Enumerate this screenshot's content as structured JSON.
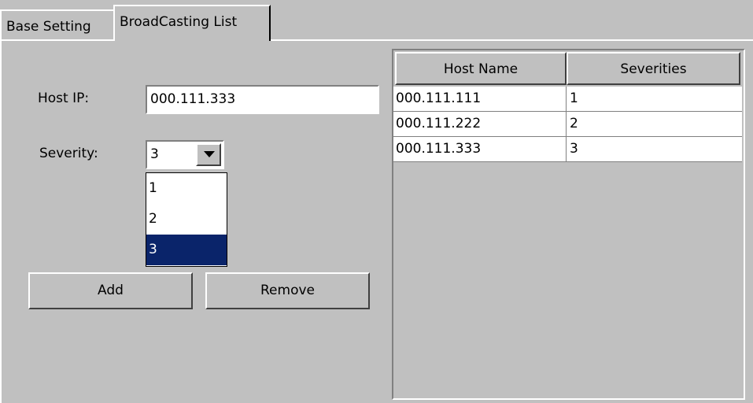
{
  "tabs": [
    {
      "label": "Base Setting",
      "active": false
    },
    {
      "label": "BroadCasting List",
      "active": true
    }
  ],
  "form": {
    "host_ip_label": "Host IP:",
    "host_ip_value": "000.111.333",
    "severity_label": "Severity:",
    "severity_value": "3",
    "severity_options": [
      "1",
      "2",
      "3"
    ],
    "severity_selected": "3"
  },
  "buttons": {
    "add": "Add",
    "remove": "Remove"
  },
  "table": {
    "columns": [
      "Host Name",
      "Severities"
    ],
    "rows": [
      {
        "host": "000.111.111",
        "severity": "1"
      },
      {
        "host": "000.111.222",
        "severity": "2"
      },
      {
        "host": "000.111.333",
        "severity": "3"
      }
    ]
  },
  "colors": {
    "window_bg": "#c0c0c0",
    "selection_bg": "#0a246a",
    "selection_fg": "#ffffff"
  },
  "icons": {
    "dropdown": "chevron-down-icon"
  }
}
